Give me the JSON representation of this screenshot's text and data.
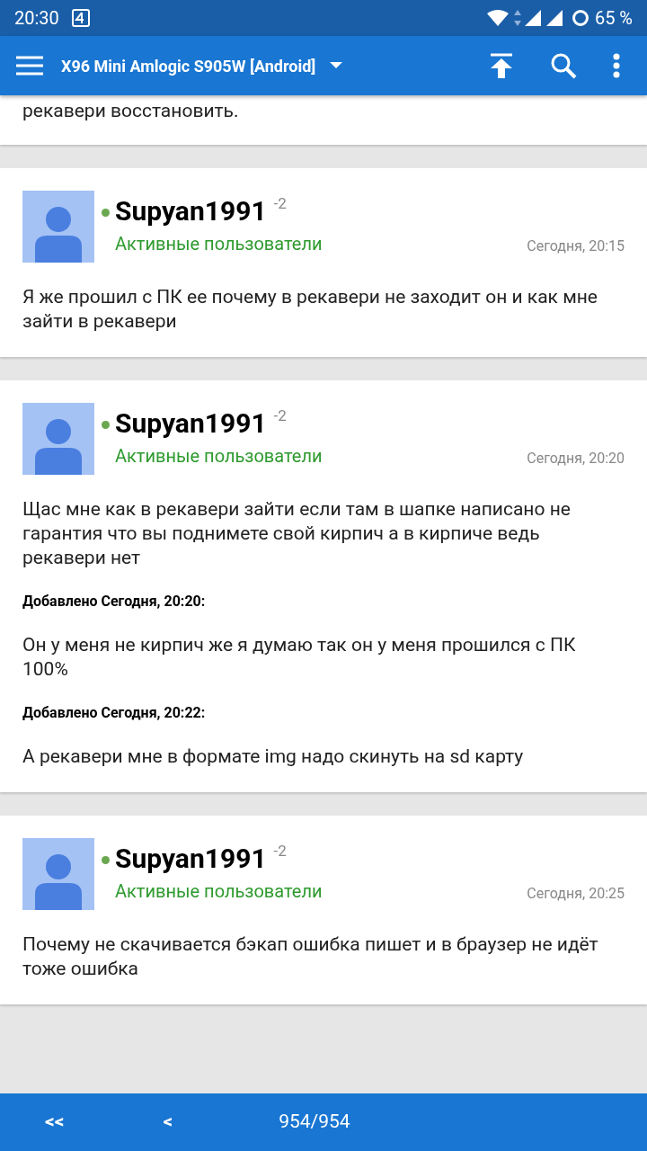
{
  "status_bar": {
    "time": "20:30",
    "battery": "65 %"
  },
  "app_bar": {
    "title": "X96 Mini Amlogic S905W [Android]"
  },
  "partial_post": {
    "text": "рекавери восстановить."
  },
  "posts": [
    {
      "author": "Supyan1991",
      "reputation": "-2",
      "online": true,
      "group": "Активные пользователи",
      "date": "Сегодня, 20:15",
      "blocks": [
        {
          "kind": "text",
          "text": "Я же прошил с ПК ее почему в рекавери не заходит он и как мне зайти в рекавери"
        }
      ]
    },
    {
      "author": "Supyan1991",
      "reputation": "-2",
      "online": true,
      "group": "Активные пользователи",
      "date": "Сегодня, 20:20",
      "blocks": [
        {
          "kind": "text",
          "text": "Щас мне как в рекавери зайти если там в шапке написано не гарантия что вы поднимете свой кирпич а в кирпиче ведь рекавери нет"
        },
        {
          "kind": "added",
          "text": "Добавлено Сегодня, 20:20:"
        },
        {
          "kind": "text",
          "text": "Он у меня не кирпич же я думаю так он у меня прошился с ПК 100%"
        },
        {
          "kind": "added",
          "text": "Добавлено Сегодня, 20:22:"
        },
        {
          "kind": "text",
          "text": "А рекавери мне в формате img надо скинуть на sd карту"
        }
      ]
    },
    {
      "author": "Supyan1991",
      "reputation": "-2",
      "online": true,
      "group": "Активные пользователи",
      "date": "Сегодня, 20:25",
      "blocks": [
        {
          "kind": "text",
          "text": "Почему не скачивается бэкап ошибка пишет и в браузер не идёт тоже ошибка"
        }
      ]
    }
  ],
  "pager": {
    "first": "<<",
    "prev": "<",
    "page": "954/954"
  }
}
